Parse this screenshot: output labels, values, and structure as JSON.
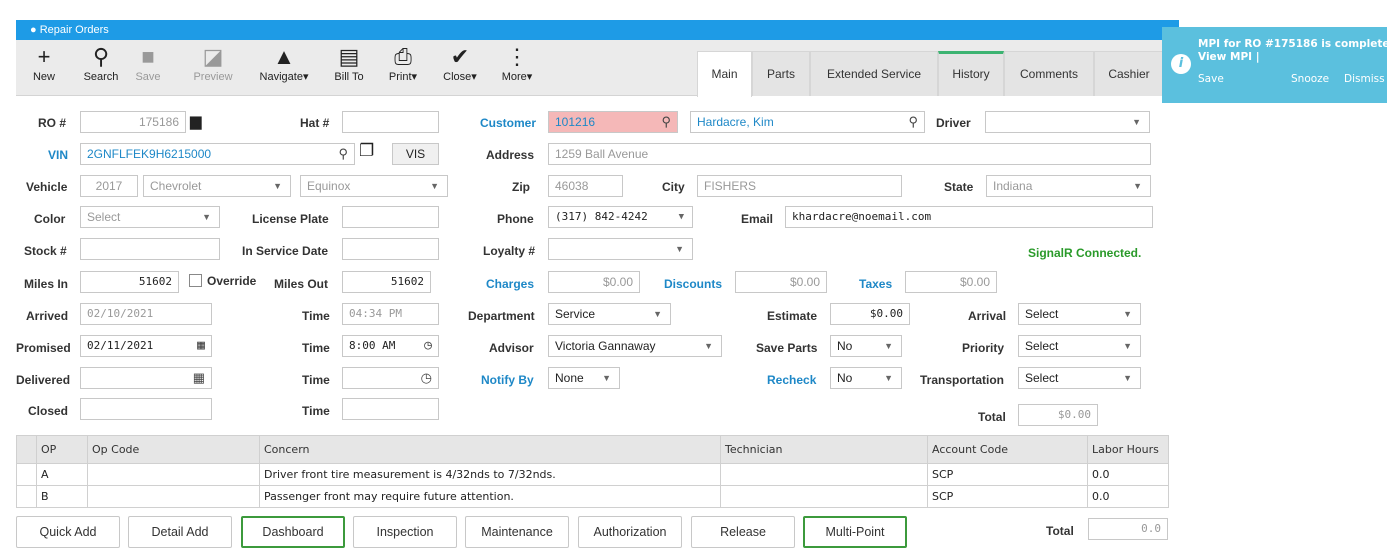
{
  "window": {
    "title": "Repair Orders"
  },
  "toolbar": [
    {
      "label": "New",
      "icon": "plus-icon",
      "glyph": "+"
    },
    {
      "label": "Search",
      "icon": "search-icon",
      "glyph": "⚲"
    },
    {
      "label": "Save",
      "icon": "save-icon",
      "glyph": "■"
    },
    {
      "label": "Preview",
      "icon": "preview-icon",
      "glyph": "◪"
    },
    {
      "label": "Navigate▾",
      "icon": "navigate-icon",
      "glyph": "▲"
    },
    {
      "label": "Bill To",
      "icon": "bill-to-icon",
      "glyph": "▤"
    },
    {
      "label": "Print▾",
      "icon": "print-icon",
      "glyph": "⎙"
    },
    {
      "label": "Close▾",
      "icon": "check-icon",
      "glyph": "✔"
    },
    {
      "label": "More▾",
      "icon": "more-icon",
      "glyph": "⋮"
    }
  ],
  "tabs": [
    "Main",
    "Parts",
    "Extended Service",
    "History",
    "Comments",
    "Cashier"
  ],
  "labels": {
    "ro": "RO #",
    "hat": "Hat #",
    "customer": "Customer",
    "driver": "Driver",
    "vin": "VIN",
    "address": "Address",
    "vehicle": "Vehicle",
    "zip": "Zip",
    "city": "City",
    "state": "State",
    "color": "Color",
    "license": "License Plate",
    "phone": "Phone",
    "email": "Email",
    "stock": "Stock #",
    "in_service": "In Service Date",
    "loyalty": "Loyalty #",
    "miles_in": "Miles In",
    "override": "Override",
    "miles_out": "Miles Out",
    "charges": "Charges",
    "discounts": "Discounts",
    "taxes": "Taxes",
    "arrived": "Arrived",
    "time": "Time",
    "department": "Department",
    "estimate": "Estimate",
    "arrival": "Arrival",
    "promised": "Promised",
    "advisor": "Advisor",
    "save_parts": "Save Parts",
    "priority": "Priority",
    "delivered": "Delivered",
    "notify_by": "Notify By",
    "recheck": "Recheck",
    "transportation": "Transportation",
    "closed": "Closed",
    "total": "Total"
  },
  "values": {
    "ro": "175186",
    "customer_id": "101216",
    "customer_name": "Hardacre, Kim",
    "vin": "2GNFLFEK9H6215000",
    "vis_button": "VIS",
    "address": "1259 Ball Avenue",
    "year": "2017",
    "make": "Chevrolet",
    "model": "Equinox",
    "zip": "46038",
    "city": "FISHERS",
    "state": "Indiana",
    "color": "Select",
    "phone": "(317) 842-4242",
    "email": "khardacre@noemail.com",
    "miles_in": "51602",
    "miles_out": "51602",
    "charges": "$0.00",
    "discounts": "$0.00",
    "taxes": "$0.00",
    "arrived": "02/10/2021",
    "arrived_time": "04:34 PM",
    "department": "Service",
    "estimate": "$0.00",
    "arrival": "Select",
    "promised": "02/11/2021",
    "promised_time": "8:00 AM",
    "advisor": "Victoria Gannaway",
    "save_parts": "No",
    "priority": "Select",
    "notify_by": "None",
    "recheck": "No",
    "transportation": "Select",
    "total": "$0.00",
    "labor_total": "0.0"
  },
  "status": "SignalR Connected.",
  "ops_table": {
    "headers": [
      "",
      "OP",
      "Op Code",
      "Concern",
      "Technician",
      "Account Code",
      "Labor Hours"
    ],
    "rows": [
      [
        "",
        "A",
        "",
        "Driver front tire measurement is 4/32nds to 7/32nds.",
        "",
        "SCP",
        "0.0"
      ],
      [
        "",
        "B",
        "",
        "Passenger front may require future attention.",
        "",
        "SCP",
        "0.0"
      ]
    ]
  },
  "bottom_buttons": [
    "Quick Add",
    "Detail Add",
    "Dashboard",
    "Inspection",
    "Maintenance",
    "Authorization",
    "Release",
    "Multi-Point"
  ],
  "toast": {
    "message": "MPI for RO #175186 is complete.",
    "link": "View MPI |",
    "actions": [
      "Save",
      "Snooze",
      "Dismiss"
    ]
  },
  "colors": {
    "accent": "#1e9be6",
    "label_blue": "#1e88c7",
    "status_green": "#2a9a2a",
    "toast": "#5bc0de"
  }
}
